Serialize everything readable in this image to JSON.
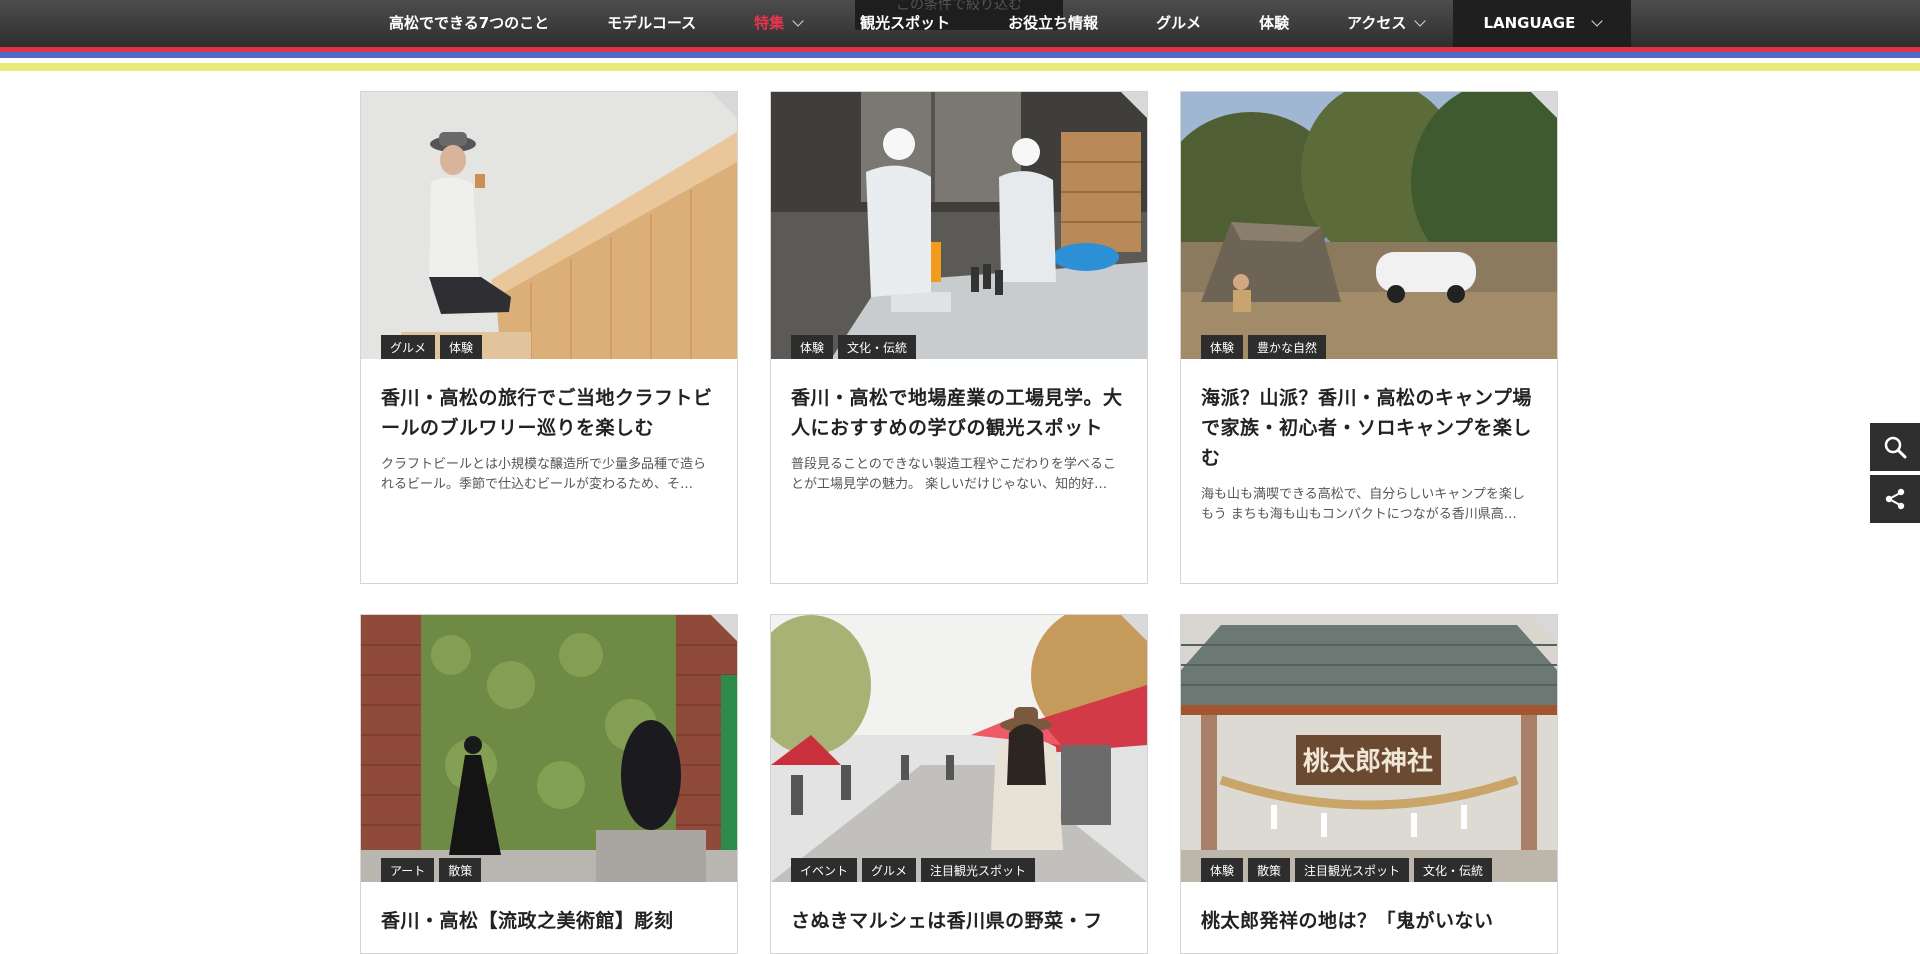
{
  "nav": {
    "items": [
      {
        "label": "高松でできる7つのこと",
        "dropdown": false,
        "active": false
      },
      {
        "label": "モデルコース",
        "dropdown": false,
        "active": false
      },
      {
        "label": "特集",
        "dropdown": true,
        "active": true
      },
      {
        "label": "観光スポット",
        "dropdown": false,
        "active": false
      },
      {
        "label": "お役立ち情報",
        "dropdown": false,
        "active": false
      },
      {
        "label": "グルメ",
        "dropdown": false,
        "active": false
      },
      {
        "label": "体験",
        "dropdown": false,
        "active": false
      },
      {
        "label": "アクセス",
        "dropdown": true,
        "active": false
      }
    ],
    "language": "LANGUAGE",
    "filter_label": "この条件で絞り込む",
    "active_color": "#e8354c",
    "stripe_colors": [
      "#e2324a",
      "#4f69c9",
      "#e8ec78"
    ]
  },
  "cards": [
    {
      "tags": [
        "グルメ",
        "体験"
      ],
      "title": "香川・高松の旅行でご当地クラフトビールのブルワリー巡りを楽しむ",
      "excerpt": "クラフトビールとは小規模な醸造所で少量多品種で造られるビール。季節で仕込むビールが変わるため、そ…"
    },
    {
      "tags": [
        "体験",
        "文化・伝統"
      ],
      "title": "香川・高松で地場産業の工場見学。大人におすすめの学びの観光スポット",
      "excerpt": "普段見ることのできない製造工程やこだわりを学べることが工場見学の魅力。 楽しいだけじゃない、知的好…"
    },
    {
      "tags": [
        "体験",
        "豊かな自然"
      ],
      "title": "海派？山派？香川・高松のキャンプ場で家族・初心者・ソロキャンプを楽しむ",
      "excerpt": "海も山も満喫できる高松で、自分らしいキャンプを楽しもう まちも海も山もコンパクトにつながる香川県高…"
    },
    {
      "tags": [
        "アート",
        "散策"
      ],
      "title": "香川・高松【流政之美術館】彫刻",
      "excerpt": ""
    },
    {
      "tags": [
        "イベント",
        "グルメ",
        "注目観光スポット"
      ],
      "title": "さぬきマルシェは香川県の野菜・フ",
      "excerpt": ""
    },
    {
      "tags": [
        "体験",
        "散策",
        "注目観光スポット",
        "文化・伝統"
      ],
      "title": "桃太郎発祥の地は？「鬼がいない",
      "excerpt": ""
    }
  ],
  "photo_signs": {
    "shrine_sign": "桃太郎神社"
  },
  "side_tools": {
    "icons": [
      "search-icon",
      "share-icon"
    ]
  }
}
